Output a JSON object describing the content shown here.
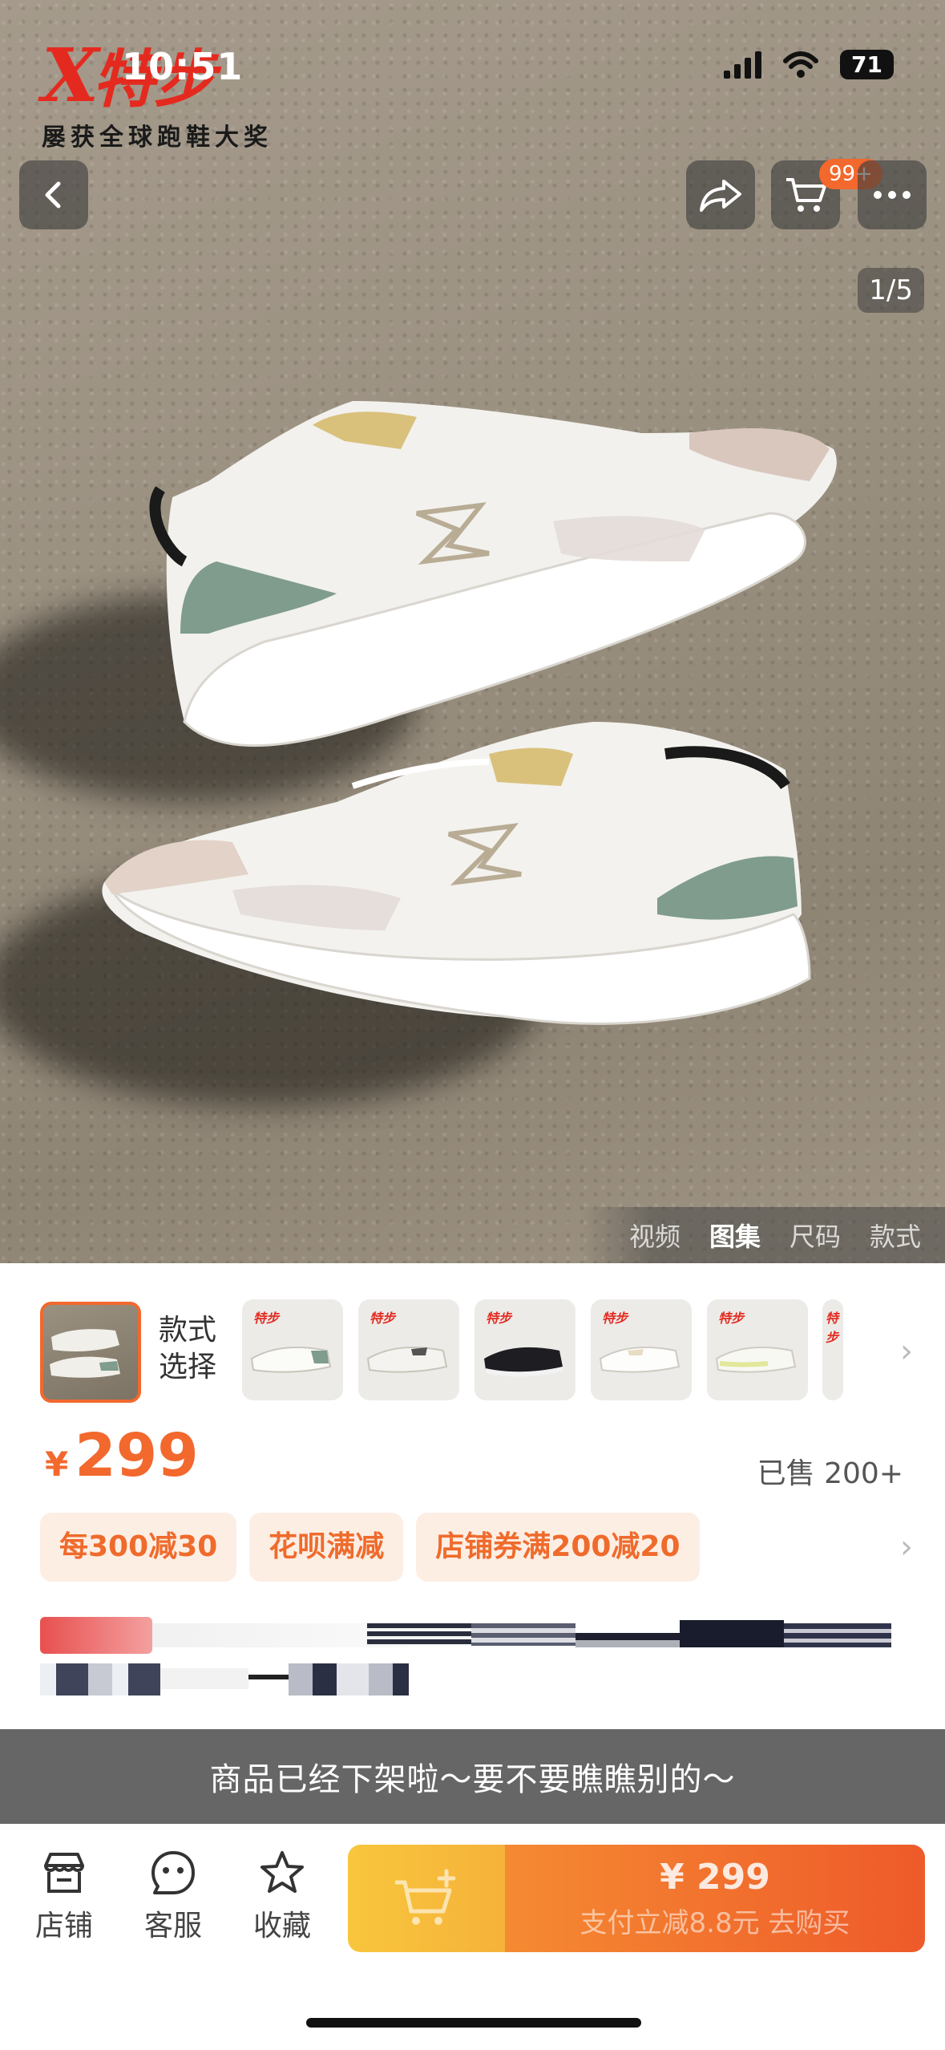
{
  "status_bar": {
    "time": "10:51",
    "battery": "71"
  },
  "brand": {
    "logo_x": "X",
    "logo_cn": "特步",
    "tagline": "屡获全球跑鞋大奖"
  },
  "header": {
    "cart_badge": "99+"
  },
  "gallery": {
    "page_indicator": "1/5",
    "tabs": [
      {
        "label": "视频",
        "active": false
      },
      {
        "label": "图集",
        "active": true
      },
      {
        "label": "尺码",
        "active": false
      },
      {
        "label": "款式",
        "active": false
      }
    ]
  },
  "variants": {
    "label": "款式选择",
    "thumb_logo": "特步"
  },
  "price": {
    "currency": "¥",
    "value": "299",
    "sold": "已售 200+"
  },
  "promotions": [
    "每300减30",
    "花呗满减",
    "店铺券满200减20"
  ],
  "notice": "商品已经下架啦～要不要瞧瞧别的～",
  "bottom_bar": {
    "store": "店铺",
    "service": "客服",
    "favorite": "收藏",
    "buy_price": "¥ 299",
    "buy_sub": "支付立减8.8元  去购买"
  },
  "colors": {
    "accent": "#f2682d",
    "brand_red": "#e42a1f",
    "banner_gray": "#666666"
  }
}
